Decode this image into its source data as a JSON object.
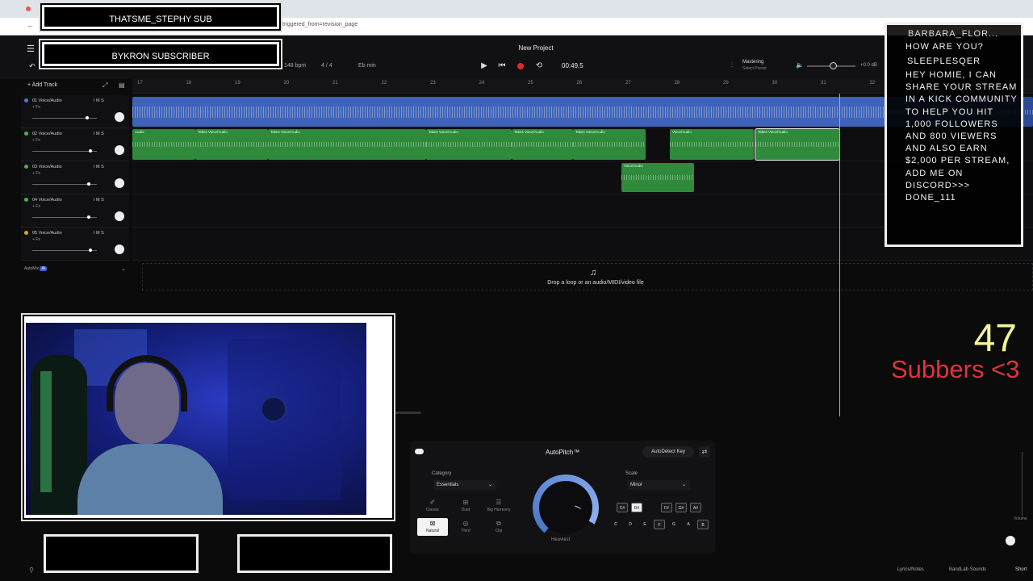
{
  "browser": {
    "url_fragment": "triggered_from=revision_page"
  },
  "overlay": {
    "top_sub_label": "THATSME_STEPHY SUB",
    "second_sub_label": "BYKRON SUBSCRIBER",
    "chat_user_1": "BARBARA_FLOR...",
    "chat_msg_1": "HOW ARE YOU?",
    "chat_user_2": "SLEEPLESQER",
    "chat_msg_2": "HEY HOMIE, I CAN SHARE YOUR STREAM IN A KICK COMMUNITY TO HELP YOU HIT 1,000 FOLLOWERS AND 800 VIEWERS AND ALSO EARN $2,000 PER STREAM, ADD ME ON DISCORD>>> DONE_111",
    "sub_count": "47",
    "sub_label": "Subbers <3"
  },
  "toolbar": {
    "project_title": "New Project",
    "bpm": "148 bpm",
    "time_signature": "4 / 4",
    "key": "Eb min",
    "time": "00:49.5",
    "mastering_label": "Mastering",
    "mastering_sub": "Select Preset",
    "db_label": "+0.0 dB",
    "add_track": "+ Add Track"
  },
  "ruler": {
    "ticks": [
      "17",
      "18",
      "19",
      "20",
      "21",
      "22",
      "23",
      "24",
      "25",
      "26",
      "27",
      "28",
      "29",
      "30",
      "31",
      "32"
    ]
  },
  "tracks": [
    {
      "name": "01 Voice/Audio",
      "fx": "+ Fx",
      "ms": "I  M  S",
      "slider": 0.85,
      "color": "#4a7bd8"
    },
    {
      "name": "02 Voice/Audio",
      "fx": "+ Fx",
      "ms": "I  M  S",
      "slider": 0.9,
      "color": "#4caf50"
    },
    {
      "name": "03 Voice/Audio",
      "fx": "+ Fx",
      "ms": "I  M  S",
      "slider": 0.88,
      "color": "#4caf50"
    },
    {
      "name": "04 Voice/Audio",
      "fx": "+ Fx",
      "ms": "I  M  S",
      "slider": 0.88,
      "color": "#4caf50"
    },
    {
      "name": "05 Voice/Audio",
      "fx": "+ Fx",
      "ms": "I  M  S",
      "slider": 0.9,
      "color": "#e0a030"
    }
  ],
  "clips": {
    "audio_label": "Audio",
    "takes_label": "Takes  Voice/Audio",
    "voice_audio_label": "Voice/Audio"
  },
  "automix": {
    "label": "AutoMix",
    "badge": "AI"
  },
  "drop_zone": {
    "text": "Drop a loop or an audio/MIDI/video file"
  },
  "autopitch": {
    "title": "AutoPitch™",
    "detect_label": "AutoDetect Key",
    "category_label": "Category",
    "category_value": "Essentials",
    "options": [
      "Classic",
      "Duet",
      "Big Harmony",
      "Natural",
      "Third",
      "Clip"
    ],
    "knob_label": "Heaviest",
    "scale_label": "Scale",
    "scale_value": "Minor",
    "sharp_keys": [
      "C#",
      "D#",
      "F#",
      "G#",
      "A#"
    ],
    "natural_keys": [
      "C",
      "D",
      "E",
      "F",
      "G",
      "A",
      "B"
    ]
  },
  "status": {
    "lyrics": "Lyrics/Notes",
    "sounds": "BandLab Sounds",
    "shortcuts": "Short",
    "volume": "Volume"
  },
  "colors": {
    "accent_blue": "#4a7bd8",
    "accent_green": "#4caf50",
    "record_red": "#e02b2b",
    "sub_count": "#f4f49a",
    "sub_label": "#e0343b"
  }
}
